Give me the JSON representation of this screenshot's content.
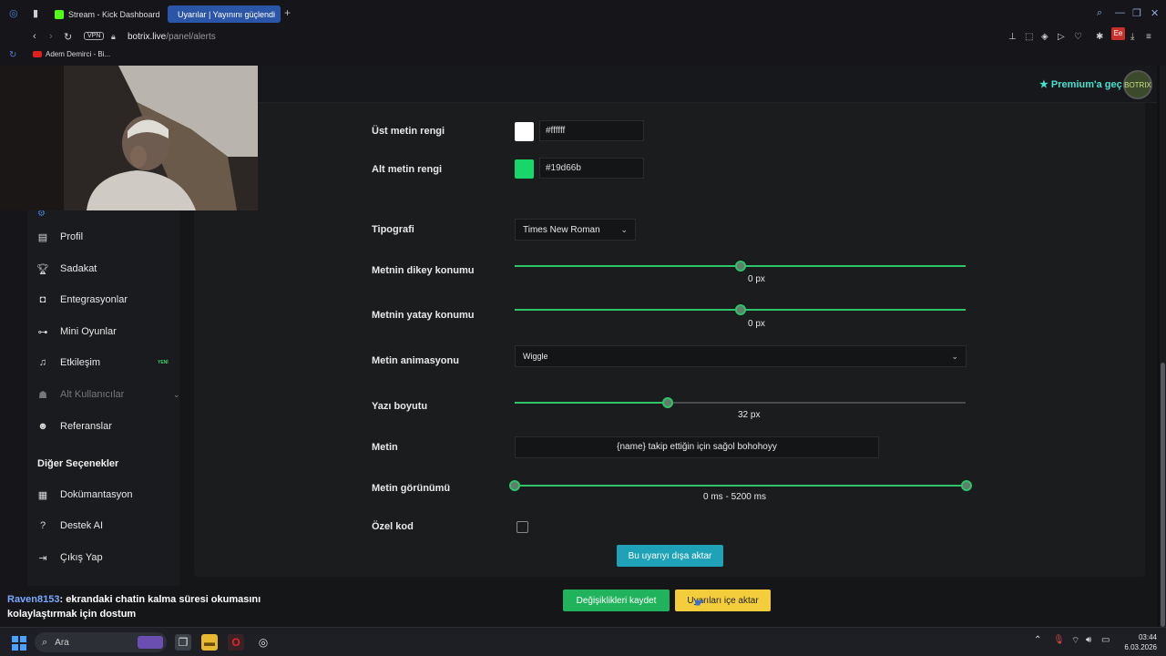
{
  "browser": {
    "tabs": [
      {
        "title": "Stream - Kick Dashboard",
        "active": false,
        "color": "#53fc18"
      },
      {
        "title": "Uyarılar | Yayınını güçlendi",
        "active": true,
        "color": "#ffffff"
      }
    ],
    "vpn_label": "VPN",
    "url_host": "botrix.live",
    "url_path": "/panel/alerts",
    "extension_badge": "Ee",
    "bookmark": "Adem Demirci - Bi..."
  },
  "header": {
    "premium_label": "Premium'a geç",
    "avatar_text": "BOTRIX"
  },
  "sidebar": {
    "items": [
      {
        "label": "Profil",
        "icon": "id-card-icon"
      },
      {
        "label": "Sadakat",
        "icon": "trophy-icon"
      },
      {
        "label": "Entegrasyonlar",
        "icon": "integration-icon"
      },
      {
        "label": "Mini Oyunlar",
        "icon": "gamepad-icon"
      },
      {
        "label": "Etkileşim",
        "icon": "music-note-icon",
        "badge": "YENİ"
      },
      {
        "label": "Alt Kullanıcılar",
        "icon": "users-icon",
        "disabled": true
      },
      {
        "label": "Referanslar",
        "icon": "people-icon"
      }
    ],
    "section_title": "Diğer Seçenekler",
    "other_items": [
      {
        "label": "Dokümantasyon",
        "icon": "book-icon"
      },
      {
        "label": "Destek AI",
        "icon": "question-icon"
      },
      {
        "label": "Çıkış Yap",
        "icon": "logout-icon"
      }
    ]
  },
  "form": {
    "top_color_label": "Üst metin rengi",
    "top_color_value": "#ffffff",
    "bottom_color_label": "Alt metin rengi",
    "bottom_color_value": "#19d66b",
    "typography_label": "Tipografi",
    "typography_value": "Times New Roman",
    "vertical_label": "Metnin dikey konumu",
    "vertical_value": "0",
    "vertical_unit": "px",
    "vertical_fraction": 0.5,
    "horizontal_label": "Metnin yatay konumu",
    "horizontal_value": "0",
    "horizontal_unit": "px",
    "horizontal_fraction": 0.5,
    "animation_label": "Metin animasyonu",
    "animation_value": "Wiggle",
    "size_label": "Yazı boyutu",
    "size_value": "32",
    "size_unit": "px",
    "size_fraction": 0.34,
    "text_label": "Metin",
    "text_value": "{name} takip ettiğin için sağol bohohoyy",
    "visibility_label": "Metin görünümü",
    "visibility_start": "0",
    "visibility_end": "5200",
    "visibility_unit": "ms",
    "visibility_sep": "-",
    "custom_code_label": "Özel kod",
    "custom_code_checked": false,
    "export_button": "Bu uyarıyı dışa aktar",
    "save_button": "Değişiklikleri kaydet",
    "import_button": "Uyarıları içe aktar"
  },
  "chat": {
    "user": "Raven8153",
    "message": ": ekrandaki chatin kalma süresi okumasını kolaylaştırmak için dostum"
  },
  "taskbar": {
    "search_placeholder": "Ara",
    "time": "03:44",
    "date": "6.03.2026"
  },
  "colors": {
    "accent_green": "#2fc46b",
    "export_button": "#1fa2b8",
    "save_button": "#21b25c",
    "import_button": "#f3cd3c",
    "premium": "#46e0d0"
  }
}
